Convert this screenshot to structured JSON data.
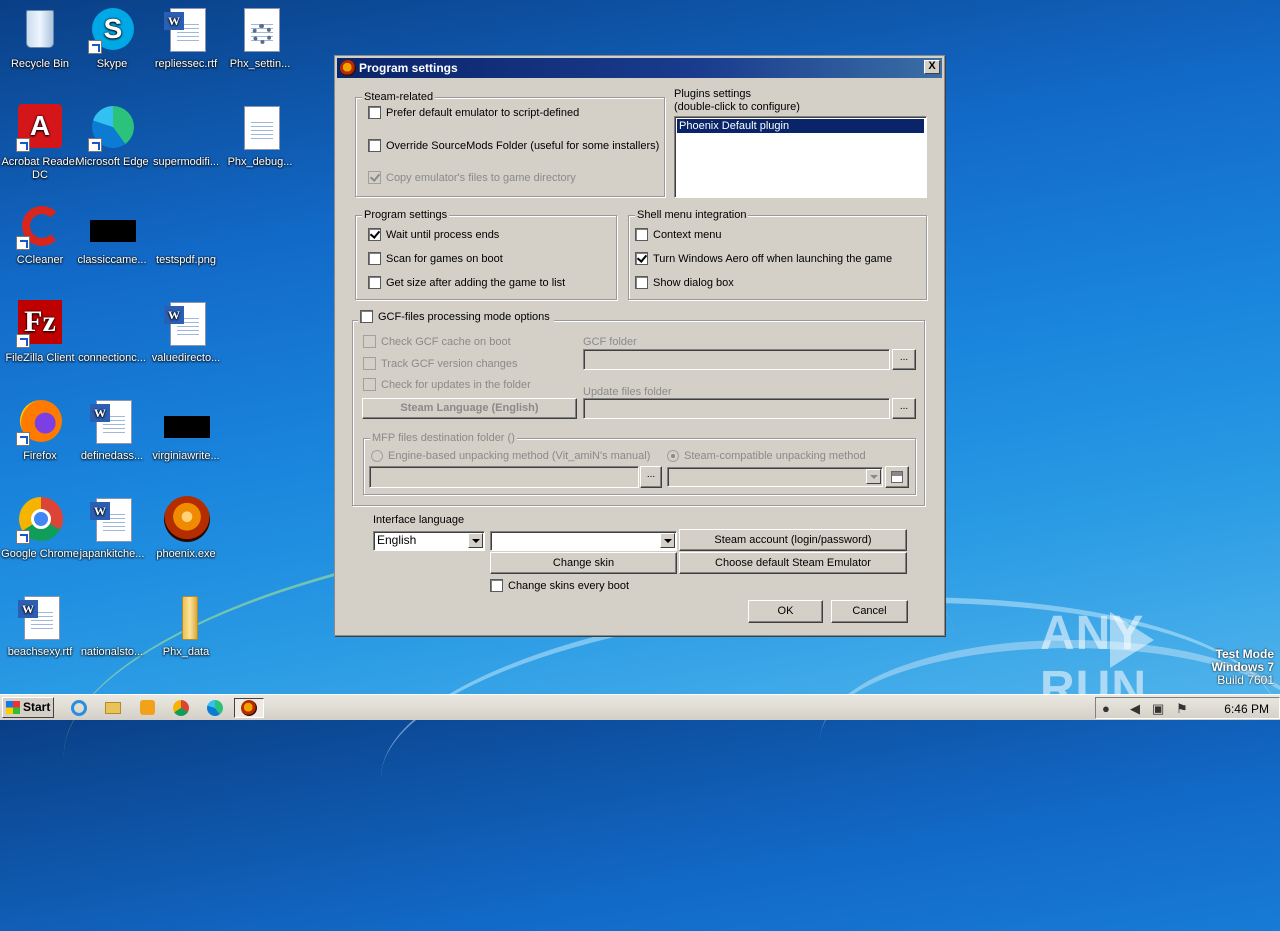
{
  "desktop": {
    "icons": [
      {
        "label": "Recycle Bin",
        "icon": "recycle-bin-icon"
      },
      {
        "label": "Skype",
        "icon": "skype-icon"
      },
      {
        "label": "repliessec.rtf",
        "icon": "word-document-icon"
      },
      {
        "label": "Phx_settin...",
        "icon": "settings-file-icon"
      },
      {
        "label": "Acrobat Reader DC",
        "icon": "acrobat-icon"
      },
      {
        "label": "Microsoft Edge",
        "icon": "edge-icon"
      },
      {
        "label": "supermodifi...",
        "icon": "blank-file-icon"
      },
      {
        "label": "Phx_debug...",
        "icon": "text-file-icon"
      },
      {
        "label": "CCleaner",
        "icon": "ccleaner-icon"
      },
      {
        "label": "classiccame...",
        "icon": "image-file-icon"
      },
      {
        "label": "testspdf.png",
        "icon": "image-file-icon"
      },
      {
        "label": "FileZilla Client",
        "icon": "filezilla-icon"
      },
      {
        "label": "connectionc...",
        "icon": "blank-file-icon"
      },
      {
        "label": "valuedirecto...",
        "icon": "word-document-icon"
      },
      {
        "label": "Firefox",
        "icon": "firefox-icon"
      },
      {
        "label": "definedass...",
        "icon": "word-document-icon"
      },
      {
        "label": "virginiawrite...",
        "icon": "image-file-icon"
      },
      {
        "label": "Google Chrome",
        "icon": "chrome-icon"
      },
      {
        "label": "japankitche...",
        "icon": "word-document-icon"
      },
      {
        "label": "phoenix.exe",
        "icon": "phoenix-icon"
      },
      {
        "label": "beachsexy.rtf",
        "icon": "word-document-icon"
      },
      {
        "label": "nationalsto...",
        "icon": "blank-file-icon"
      },
      {
        "label": "Phx_data",
        "icon": "folder-icon"
      }
    ]
  },
  "dialog": {
    "title": "Program settings",
    "close_label": "X",
    "steam_related": {
      "legend": "Steam-related",
      "prefer_default": {
        "label": "Prefer default emulator to script-defined",
        "checked": false
      },
      "override_sourcemods": {
        "label": "Override SourceMods Folder (useful for some installers)",
        "checked": false
      },
      "copy_emulator": {
        "label": "Copy emulator's files to game directory",
        "checked": true,
        "disabled": true
      }
    },
    "plugins": {
      "title_line1": "Plugins settings",
      "title_line2": "(double-click to configure)",
      "items": [
        "Phoenix Default plugin"
      ]
    },
    "program_settings": {
      "legend": "Program settings",
      "wait_process": {
        "label": "Wait until process ends",
        "checked": true
      },
      "scan_boot": {
        "label": "Scan for games on boot",
        "checked": false
      },
      "get_size": {
        "label": "Get size after adding the game to list",
        "checked": false
      }
    },
    "shell_menu": {
      "legend": "Shell menu integration",
      "context_menu": {
        "label": "Context menu",
        "checked": false
      },
      "aero_off": {
        "label": "Turn Windows Aero off when launching the game",
        "checked": true
      },
      "show_dialog": {
        "label": "Show dialog box",
        "checked": false
      }
    },
    "gcf": {
      "legend": "GCF-files processing mode options",
      "check_cache": "Check GCF cache on boot",
      "track_version": "Track GCF version changes",
      "check_updates": "Check for updates in the folder",
      "steam_language_button": "Steam Language (English)",
      "gcf_folder_label": "GCF folder",
      "update_folder_label": "Update files folder",
      "browse_label": "...",
      "mfp_legend": "MFP files destination folder ()",
      "engine_method": "Engine-based unpacking method (Vit_amiN's manual)",
      "steam_method": "Steam-compatible unpacking method"
    },
    "interface_language": {
      "label": "Interface language",
      "selected": "English",
      "skin_selected": ""
    },
    "buttons": {
      "steam_account": "Steam account (login/password)",
      "change_skin": "Change skin",
      "choose_emulator": "Choose default Steam Emulator",
      "change_skins_every_boot": "Change skins every boot",
      "ok": "OK",
      "cancel": "Cancel"
    }
  },
  "taskbar": {
    "start_label": "Start",
    "clock": "6:46 PM",
    "pinned": [
      "ie-icon",
      "explorer-icon",
      "media-player-icon",
      "chrome-icon",
      "edge-icon",
      "phoenix-icon"
    ]
  },
  "watermark": {
    "brand_left": "ANY",
    "brand_right": "RUN",
    "line1": "Test Mode",
    "line2": "Windows 7",
    "line3": "Build 7601"
  }
}
